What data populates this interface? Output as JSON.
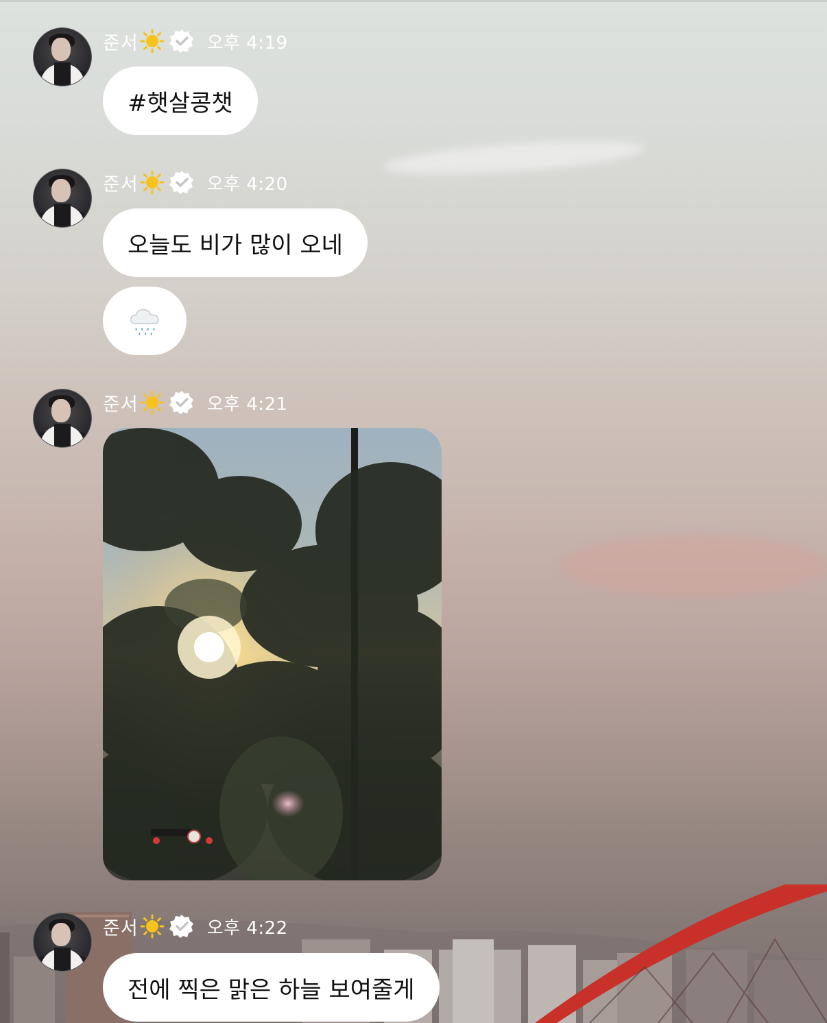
{
  "messages": [
    {
      "sender": "준서",
      "sender_emoji": "sun-icon",
      "verified": "verified-badge-icon",
      "time": "오후 4:19",
      "bubbles": [
        "#햇살콩챗"
      ]
    },
    {
      "sender": "준서",
      "sender_emoji": "sun-icon",
      "verified": "verified-badge-icon",
      "time": "오후 4:20",
      "bubbles": [
        "오늘도 비가 많이 오네"
      ],
      "emoji_bubble": "rain-cloud-icon"
    },
    {
      "sender": "준서",
      "sender_emoji": "sun-icon",
      "verified": "verified-badge-icon",
      "time": "오후 4:21",
      "photo": "sunset-trees-photo"
    },
    {
      "sender": "준서",
      "sender_emoji": "sun-icon",
      "verified": "verified-badge-icon",
      "time": "오후 4:22",
      "bubbles": [
        "전에 찍은 맑은 하늘 보여줄게"
      ]
    }
  ],
  "colors": {
    "bubble_bg": "#ffffff",
    "bubble_text": "#111111",
    "meta_text": "#ffffff",
    "bridge_red": "#c8312a"
  }
}
